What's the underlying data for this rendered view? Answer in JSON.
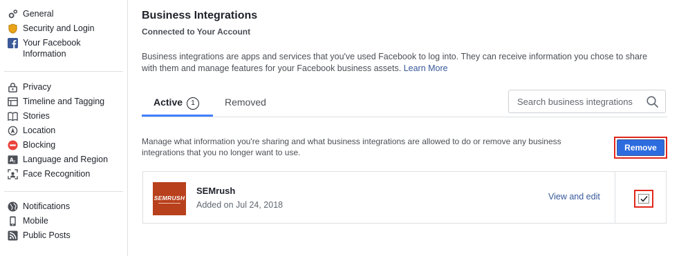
{
  "sidebar": {
    "groups": [
      {
        "items": [
          {
            "label": "General",
            "icon": "gear-icon"
          },
          {
            "label": "Security and Login",
            "icon": "shield-icon"
          },
          {
            "label": "Your Facebook Information",
            "icon": "facebook-icon"
          }
        ]
      },
      {
        "items": [
          {
            "label": "Privacy",
            "icon": "lock-icon"
          },
          {
            "label": "Timeline and Tagging",
            "icon": "timeline-icon"
          },
          {
            "label": "Stories",
            "icon": "book-icon"
          },
          {
            "label": "Location",
            "icon": "location-icon"
          },
          {
            "label": "Blocking",
            "icon": "blocking-icon"
          },
          {
            "label": "Language and Region",
            "icon": "language-icon"
          },
          {
            "label": "Face Recognition",
            "icon": "face-recognition-icon"
          }
        ]
      },
      {
        "items": [
          {
            "label": "Notifications",
            "icon": "globe-icon"
          },
          {
            "label": "Mobile",
            "icon": "mobile-icon"
          },
          {
            "label": "Public Posts",
            "icon": "rss-icon"
          }
        ]
      }
    ]
  },
  "main": {
    "title": "Business Integrations",
    "subtitle": "Connected to Your Account",
    "description": "Business integrations are apps and services that you've used Facebook to log into. They can receive information you chose to share with them and manage features for your Facebook business assets.",
    "learn_more": "Learn More",
    "tabs": {
      "active_label": "Active",
      "active_count": "1",
      "removed_label": "Removed"
    },
    "search": {
      "placeholder": "Search business integrations"
    },
    "manage_text": "Manage what information you're sharing and what business integrations are allowed to do or remove any business integrations that you no longer want to use.",
    "remove_label": "Remove",
    "integration": {
      "name": "SEMrush",
      "added": "Added on Jul 24, 2018",
      "view_edit": "View and edit",
      "logo_text": "SEMRUSH",
      "checked": true
    }
  },
  "colors": {
    "accent": "#4080ff",
    "link": "#365899",
    "button": "#2d6cdf",
    "highlight": "#e0271a",
    "logo": "#b8401c"
  }
}
